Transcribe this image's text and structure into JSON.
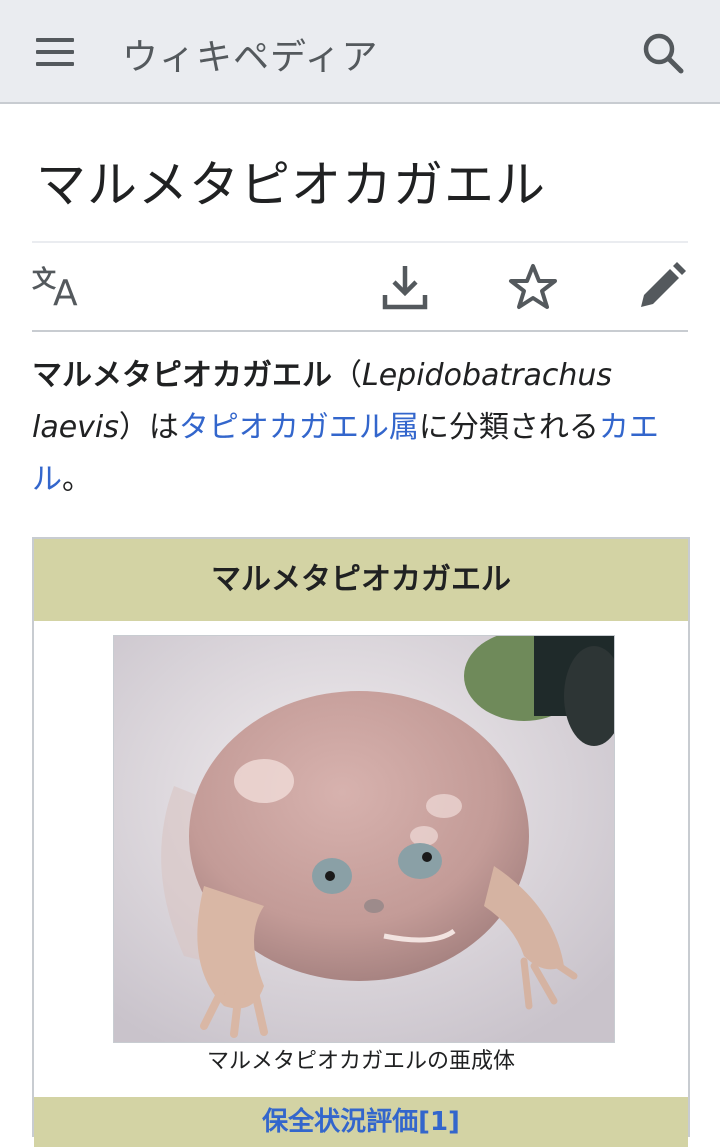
{
  "header": {
    "site_name": "ウィキペディア",
    "menu_icon": "hamburger-menu-icon",
    "search_icon": "search-icon"
  },
  "article": {
    "title": "マルメタピオカガエル",
    "actions": [
      "language-icon",
      "download-icon",
      "star-icon",
      "edit-pencil-icon"
    ],
    "lead": {
      "bold_name": "マルメタピオカガエル",
      "paren_open": "（",
      "scientific_name": "Lepidobatrachus laevis",
      "paren_close": "）は",
      "link_genus": "タピオカガエル属",
      "text_mid": "に分類される",
      "link_frog": "カエル",
      "text_end": "。"
    }
  },
  "infobox": {
    "header": "マルメタピオカガエル",
    "caption": "マルメタピオカガエルの亜成体",
    "next_section": "保全状況評価[1]"
  },
  "colors": {
    "header_bg": "#eaecf0",
    "link": "#3366cc",
    "infobox_header_bg": "#d3d3a4",
    "icon": "#54595d"
  }
}
